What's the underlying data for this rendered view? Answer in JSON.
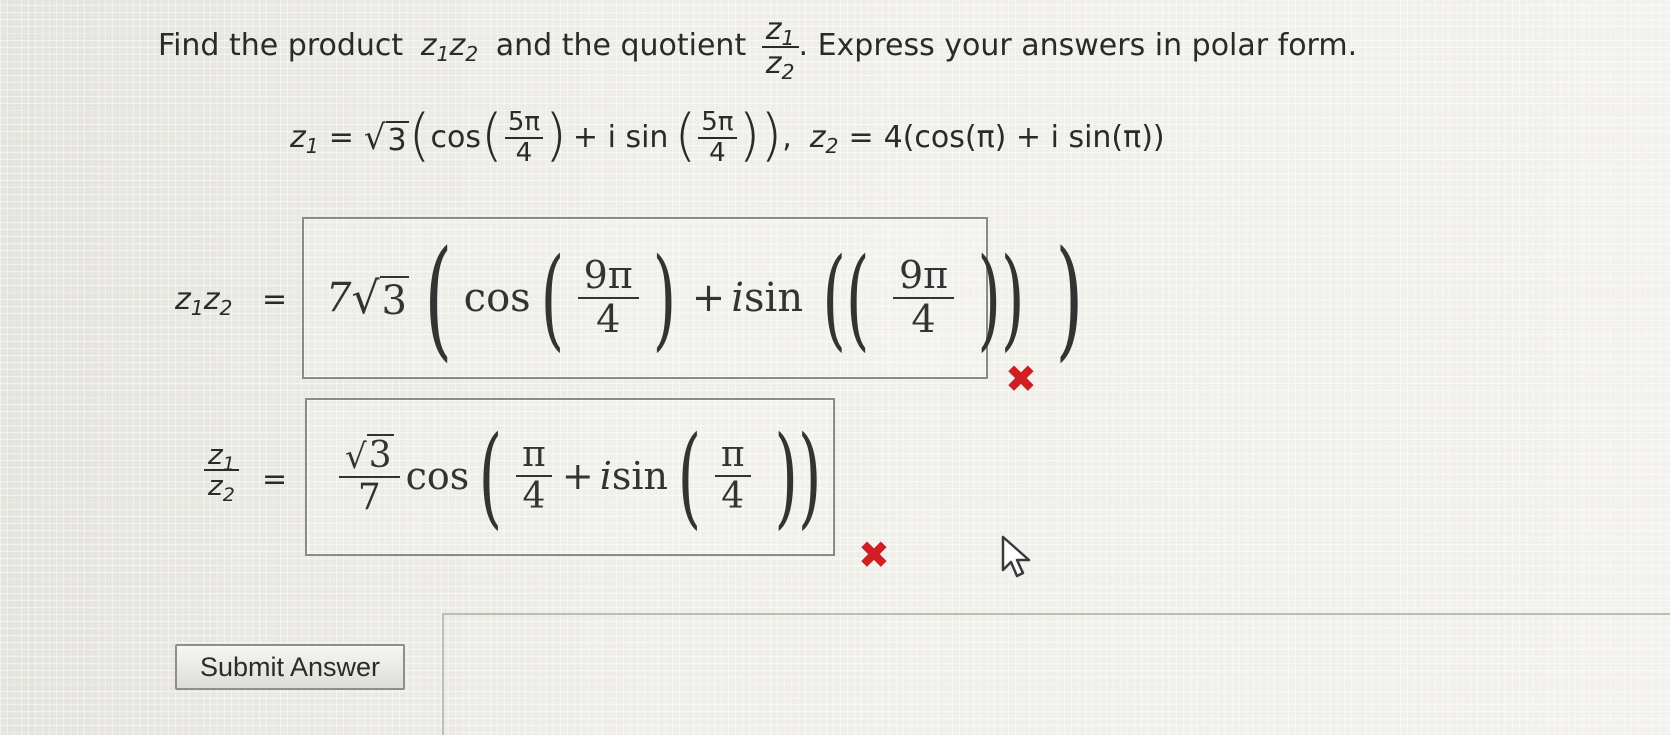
{
  "question": {
    "prefix": "Find the product",
    "product": "z",
    "s1": "1",
    "product2": "z",
    "s2": "2",
    "mid": "and the quotient",
    "q_num": "z",
    "q_num_sub": "1",
    "q_den": "z",
    "q_den_sub": "2",
    "suffix": ". Express your answers in polar form."
  },
  "given": {
    "z1_label": "z",
    "z1_sub": "1",
    "eq": "=",
    "root": "3",
    "cos": "cos",
    "angle_num": "5π",
    "angle_den": "4",
    "plus_i_sin": "+ i sin",
    "sep": ",",
    "z2_label": "z",
    "z2_sub": "2",
    "z2_rhs": "4(cos(π) + i sin(π))"
  },
  "product_row": {
    "lhs_a": "z",
    "lhs_a_sub": "1",
    "lhs_b": "z",
    "lhs_b_sub": "2",
    "eq": "=",
    "coef": "7",
    "root": "3",
    "cos": "cos",
    "angle_num": "9π",
    "angle_den": "4",
    "plus": "+",
    "i": "i",
    "sin": "sin",
    "status": "incorrect",
    "mark": "✖"
  },
  "quotient_row": {
    "lhs_num": "z",
    "lhs_num_sub": "1",
    "lhs_den": "z",
    "lhs_den_sub": "2",
    "eq": "=",
    "root": "3",
    "coef_den": "7",
    "cos": "cos",
    "angle_num": "π",
    "angle_den": "4",
    "plus": "+",
    "i": "i",
    "sin": "sin",
    "status": "incorrect",
    "mark": "✖"
  },
  "submit": {
    "label": "Submit Answer"
  },
  "icons": {
    "cursor": "mouse-pointer-icon",
    "incorrect": "x-mark-icon"
  },
  "colors": {
    "error": "#d01f24",
    "box_border": "#8a8a8a"
  }
}
